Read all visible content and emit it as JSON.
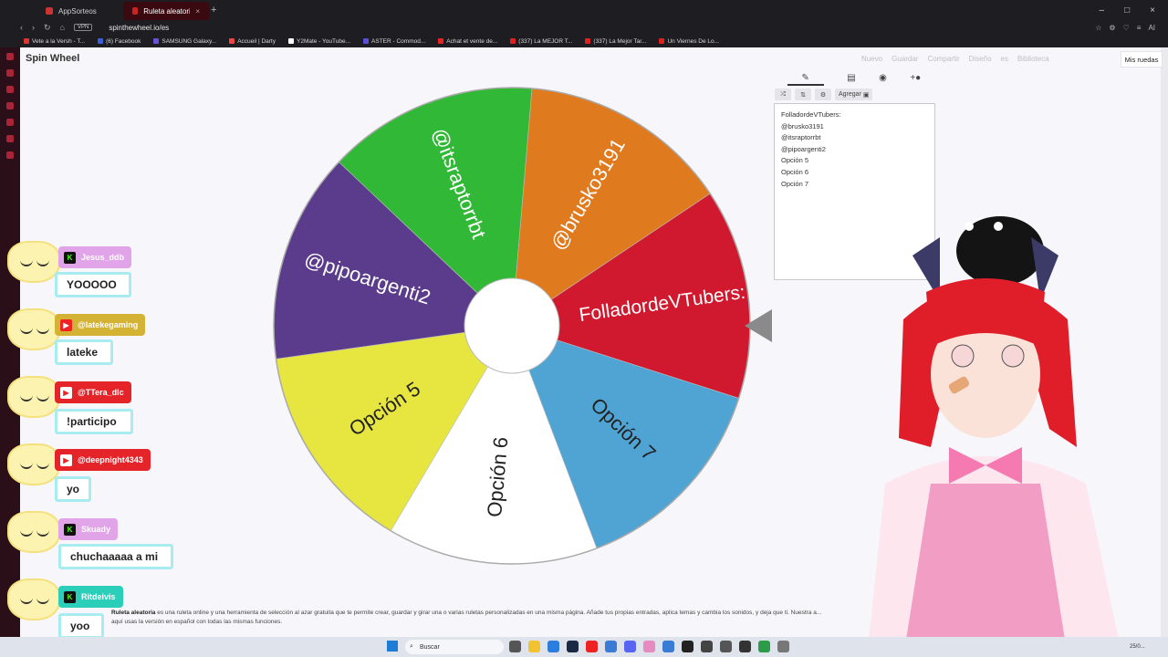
{
  "browser": {
    "tabs": [
      {
        "label": "AppSorteos",
        "active": false
      },
      {
        "label": "Ruleta aleatoria online – n",
        "active": true
      }
    ],
    "vpn": "VPN",
    "url": "spinthewheel.io/es",
    "ai_label": "AI",
    "bookmarks": [
      "Vete a la Versh - T...",
      "(6) Facebook",
      "SAMSUNG Galaxy...",
      "Accueil | Darty",
      "Y2Mate - YouTube...",
      "ASTER - Commod...",
      "Achat et vente de...",
      "(337) La MEJOR T...",
      "(337) La Mejor Tar...",
      "Un Viernes De Lo..."
    ]
  },
  "app": {
    "logo": "Spin Wheel",
    "menu": [
      "Nuevo",
      "Guardar",
      "Compartir",
      "Diseño",
      "es",
      "Biblioteca"
    ],
    "mis_ruedas": "Mis ruedas",
    "add_button": "Agregar",
    "entries_title": "FolladordeVTubers:",
    "entries": [
      "@brusko3191",
      "@itsraptorrbt",
      "@pipoargenti2",
      "Opción 5",
      "Opción 6",
      "Opción 7"
    ]
  },
  "wheel": {
    "segments": [
      {
        "label": "FolladordeVTubers:",
        "color": "#d0192e"
      },
      {
        "label": "Opción 7",
        "color": "#4fa4d4"
      },
      {
        "label": "Opción 6",
        "color": "#ffffff"
      },
      {
        "label": "Opción 5",
        "color": "#e7e540"
      },
      {
        "label": "@pipoargenti2",
        "color": "#5b3b8c"
      },
      {
        "label": "@itsraptorrbt",
        "color": "#31b836"
      },
      {
        "label": "@brusko3191",
        "color": "#e07a1e"
      }
    ]
  },
  "chat": [
    {
      "user": "Jesus_ddb",
      "platform": "kick",
      "text": "YOOOOO",
      "color": "#e2a4e8"
    },
    {
      "user": "@latekegaming",
      "platform": "youtube",
      "text": "lateke",
      "color": "#d4b234"
    },
    {
      "user": "@TTera_dlc",
      "platform": "youtube",
      "text": "!participo",
      "color": "#e5242a"
    },
    {
      "user": "@deepnight4343",
      "platform": "youtube",
      "text": "yo",
      "color": "#e5242a"
    },
    {
      "user": "Skuady",
      "platform": "kick",
      "text": "chuchaaaaa a mi",
      "color": "#e2a4e8"
    },
    {
      "user": "Ritdeivis",
      "platform": "kick",
      "text": "yoo",
      "color": "#2bcfb9"
    }
  ],
  "footer": {
    "bold": "Ruleta aleatoria",
    "text": " es una ruleta online y una herramienta de selección al azar gratuita que te permite crear, guardar y girar una o varias ruletas personalizadas en una misma página. Añade tus propias entradas, aplica temas y cambia los sonidos, y deja que ti. Nuestra a...",
    "text2": "aquí usas la versión en español con todas las mismas funciones."
  },
  "taskbar": {
    "search": "Buscar",
    "date": "25/0..."
  }
}
